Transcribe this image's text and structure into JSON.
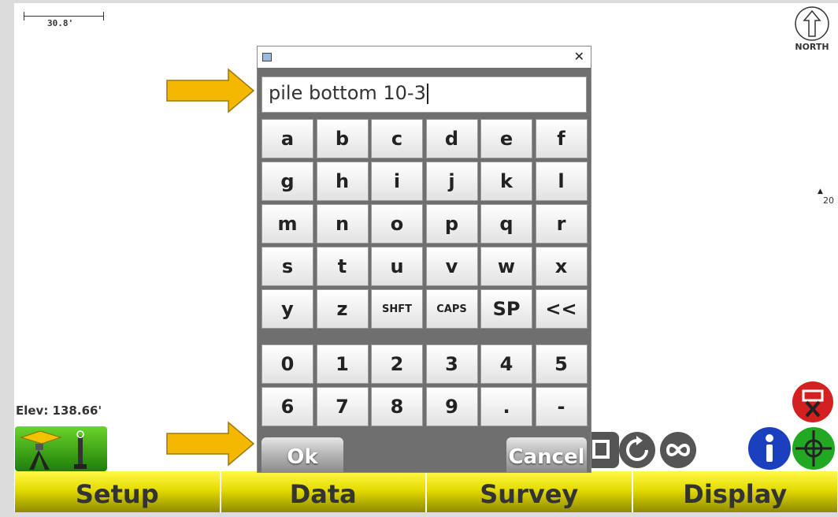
{
  "map": {
    "scale_label": "30.8'",
    "north_label": "NORTH",
    "marker_label": "20",
    "elevation_label": "Elev: 138.66'"
  },
  "dialog": {
    "text_value": "pile bottom 10-3",
    "letter_keys": [
      "a",
      "b",
      "c",
      "d",
      "e",
      "f",
      "g",
      "h",
      "i",
      "j",
      "k",
      "l",
      "m",
      "n",
      "o",
      "p",
      "q",
      "r",
      "s",
      "t",
      "u",
      "v",
      "w",
      "x",
      "y",
      "z",
      "SHFT",
      "CAPS",
      "SP",
      "<<"
    ],
    "number_keys": [
      "0",
      "1",
      "2",
      "3",
      "4",
      "5",
      "6",
      "7",
      "8",
      "9",
      ".",
      "-"
    ],
    "ok_label": "Ok",
    "cancel_label": "Cancel",
    "close_glyph": "✕"
  },
  "bottom_tabs": [
    "Setup",
    "Data",
    "Survey",
    "Display"
  ],
  "icons": {
    "arrow_color": "#f5b800",
    "gps_panel_color": "#3ba81a",
    "info_color": "#1a3fbf",
    "target_color": "#22a822",
    "stop_color": "#d32020"
  }
}
